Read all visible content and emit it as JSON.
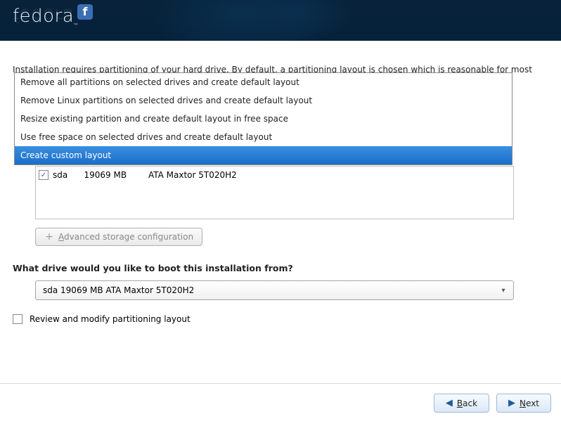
{
  "brand": "fedora",
  "intro": "Installation requires partitioning of your hard drive.  By default, a partitioning layout is chosen which is reasonable for most",
  "partition_options": [
    "Remove all partitions on selected drives and create default layout",
    "Remove Linux partitions on selected drives and create default layout",
    "Resize existing partition and create default layout in free space",
    "Use free space on selected drives and create default layout",
    "Create custom layout"
  ],
  "partition_selected_index": 4,
  "drive": {
    "checked": true,
    "name": "sda",
    "size": "19069 MB",
    "model": "ATA Maxtor 5T020H2"
  },
  "advanced_button_label": "Advanced storage configuration",
  "boot_question": "What drive would you like to boot this installation from?",
  "boot_selected": "sda    19069 MB ATA Maxtor 5T020H2",
  "review_label": "Review and modify partitioning layout",
  "review_checked": false,
  "nav": {
    "back": "Back",
    "next": "Next"
  }
}
